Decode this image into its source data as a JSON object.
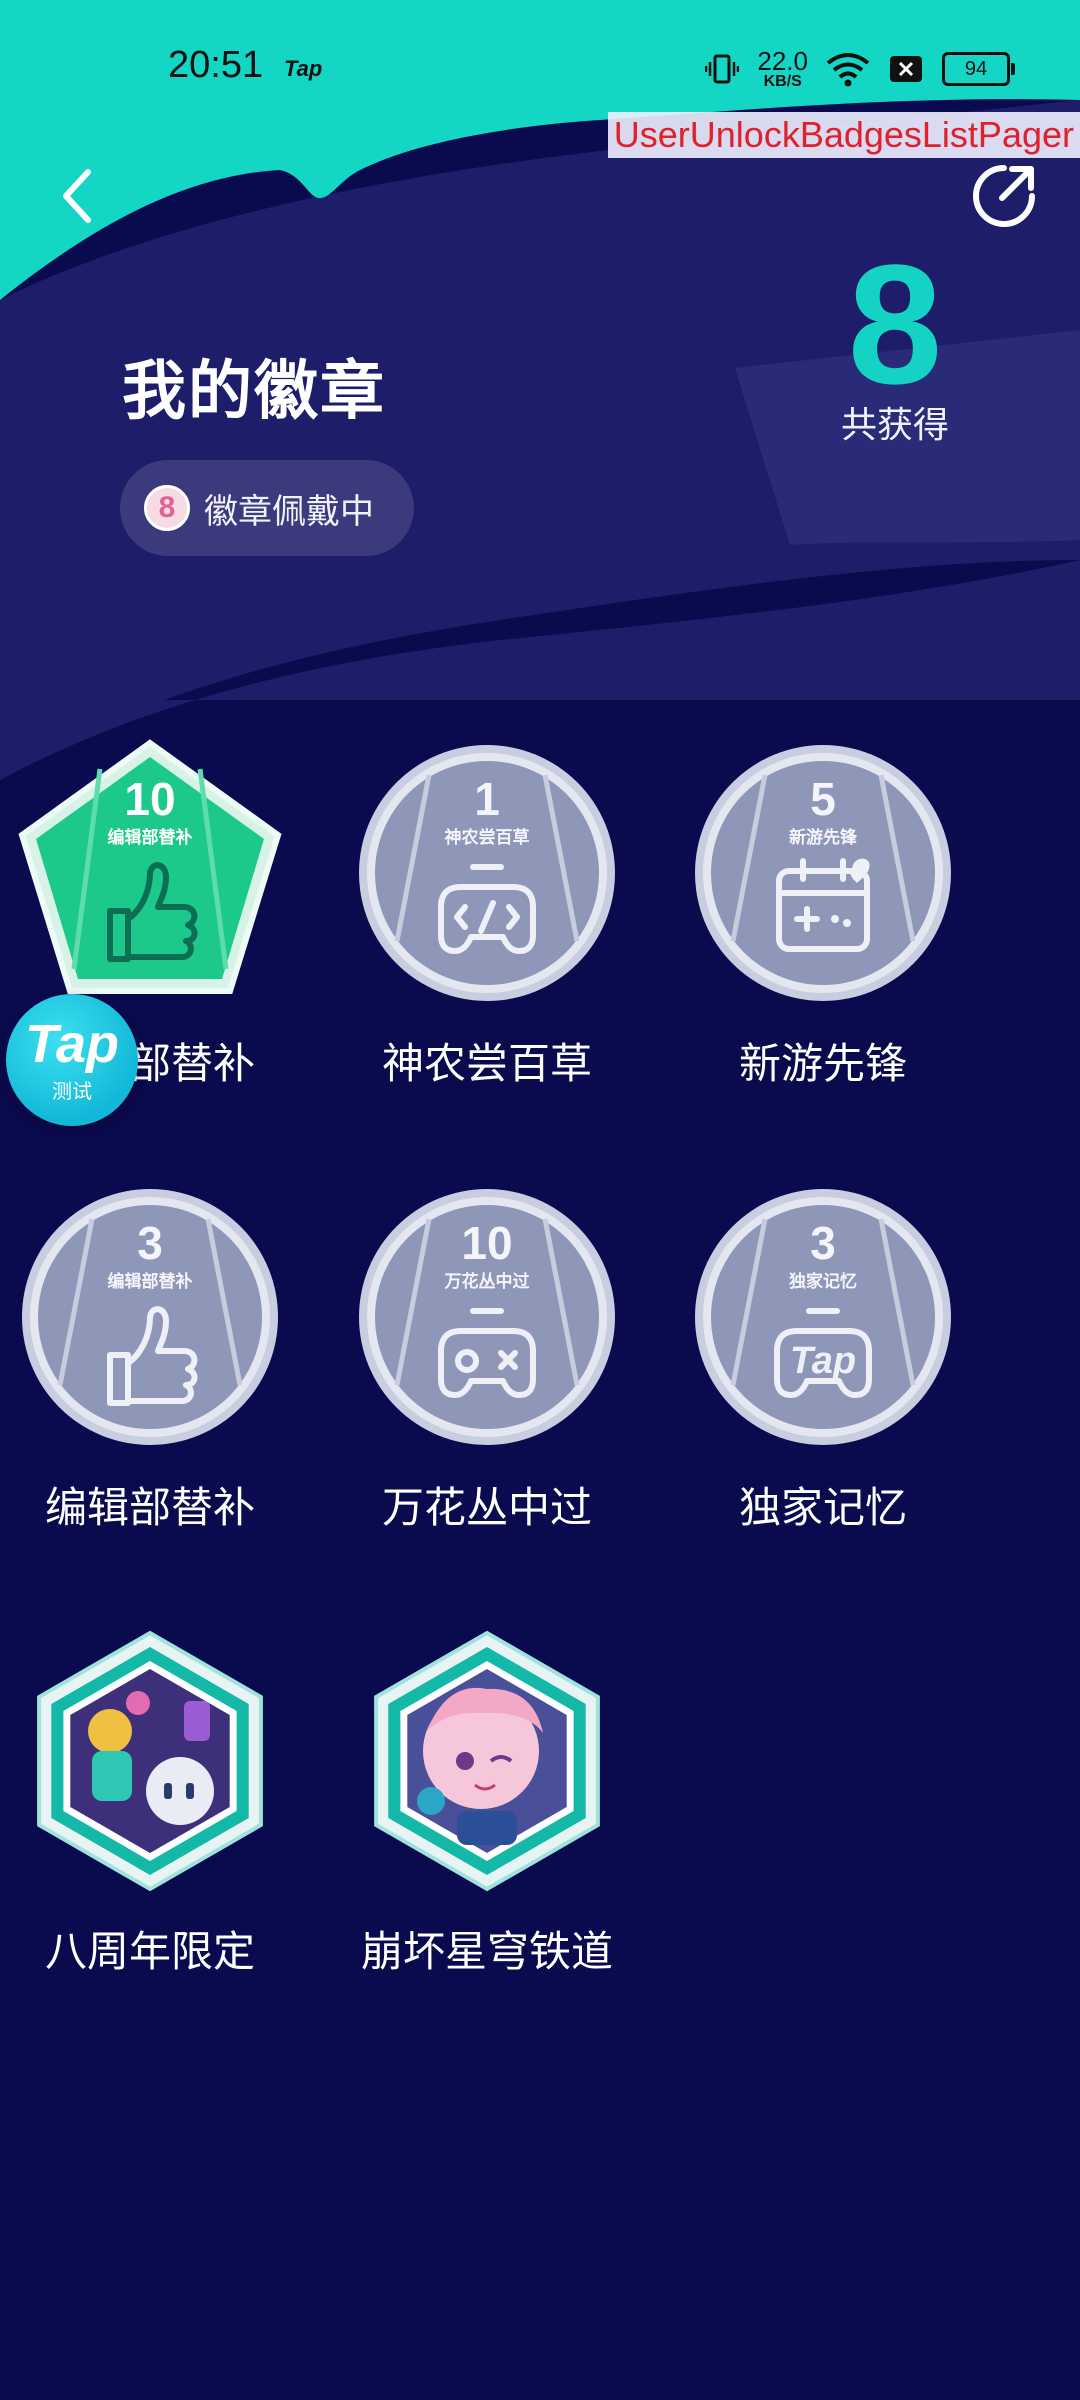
{
  "status": {
    "time": "20:51",
    "app_indicator": "Tap",
    "net_speed_value": "22.0",
    "net_speed_unit": "KB/S",
    "battery": "94"
  },
  "debug_label": "UserUnlockBadgesListPager",
  "header": {
    "title": "我的徽章",
    "wearing_count": "8",
    "wearing_label": "徽章佩戴中",
    "total_count": "8",
    "total_label": "共获得"
  },
  "badges": [
    {
      "name": "编辑部替补",
      "level": "10",
      "sub": "编辑部替补",
      "shape": "pentagon",
      "style": "green",
      "icon": "thumbs-up"
    },
    {
      "name": "神农尝百草",
      "level": "1",
      "sub": "神农尝百草",
      "shape": "circle",
      "style": "gray",
      "icon": "code-gamepad"
    },
    {
      "name": "新游先锋",
      "level": "5",
      "sub": "新游先锋",
      "shape": "circle",
      "style": "gray",
      "icon": "calendar-gamepad"
    },
    {
      "name": "编辑部替补",
      "level": "3",
      "sub": "编辑部替补",
      "shape": "circle",
      "style": "gray",
      "icon": "thumbs-up"
    },
    {
      "name": "万花丛中过",
      "level": "10",
      "sub": "万花丛中过",
      "shape": "circle",
      "style": "gray",
      "icon": "gamepad"
    },
    {
      "name": "独家记忆",
      "level": "3",
      "sub": "独家记忆",
      "shape": "circle",
      "style": "gray",
      "icon": "tap-gamepad"
    },
    {
      "name": "八周年限定",
      "shape": "hexagon",
      "style": "illustration",
      "icon": "anniversary-illustration"
    },
    {
      "name": "崩坏星穹铁道",
      "shape": "hexagon",
      "style": "illustration",
      "icon": "character-illustration"
    }
  ],
  "floating_button": {
    "title": "Tap",
    "subtitle": "测试"
  },
  "colors": {
    "accent": "#14d3c4",
    "background": "#0a0a4e",
    "badge_green": "#1dc98a",
    "badge_gray": "#8f97b8"
  }
}
